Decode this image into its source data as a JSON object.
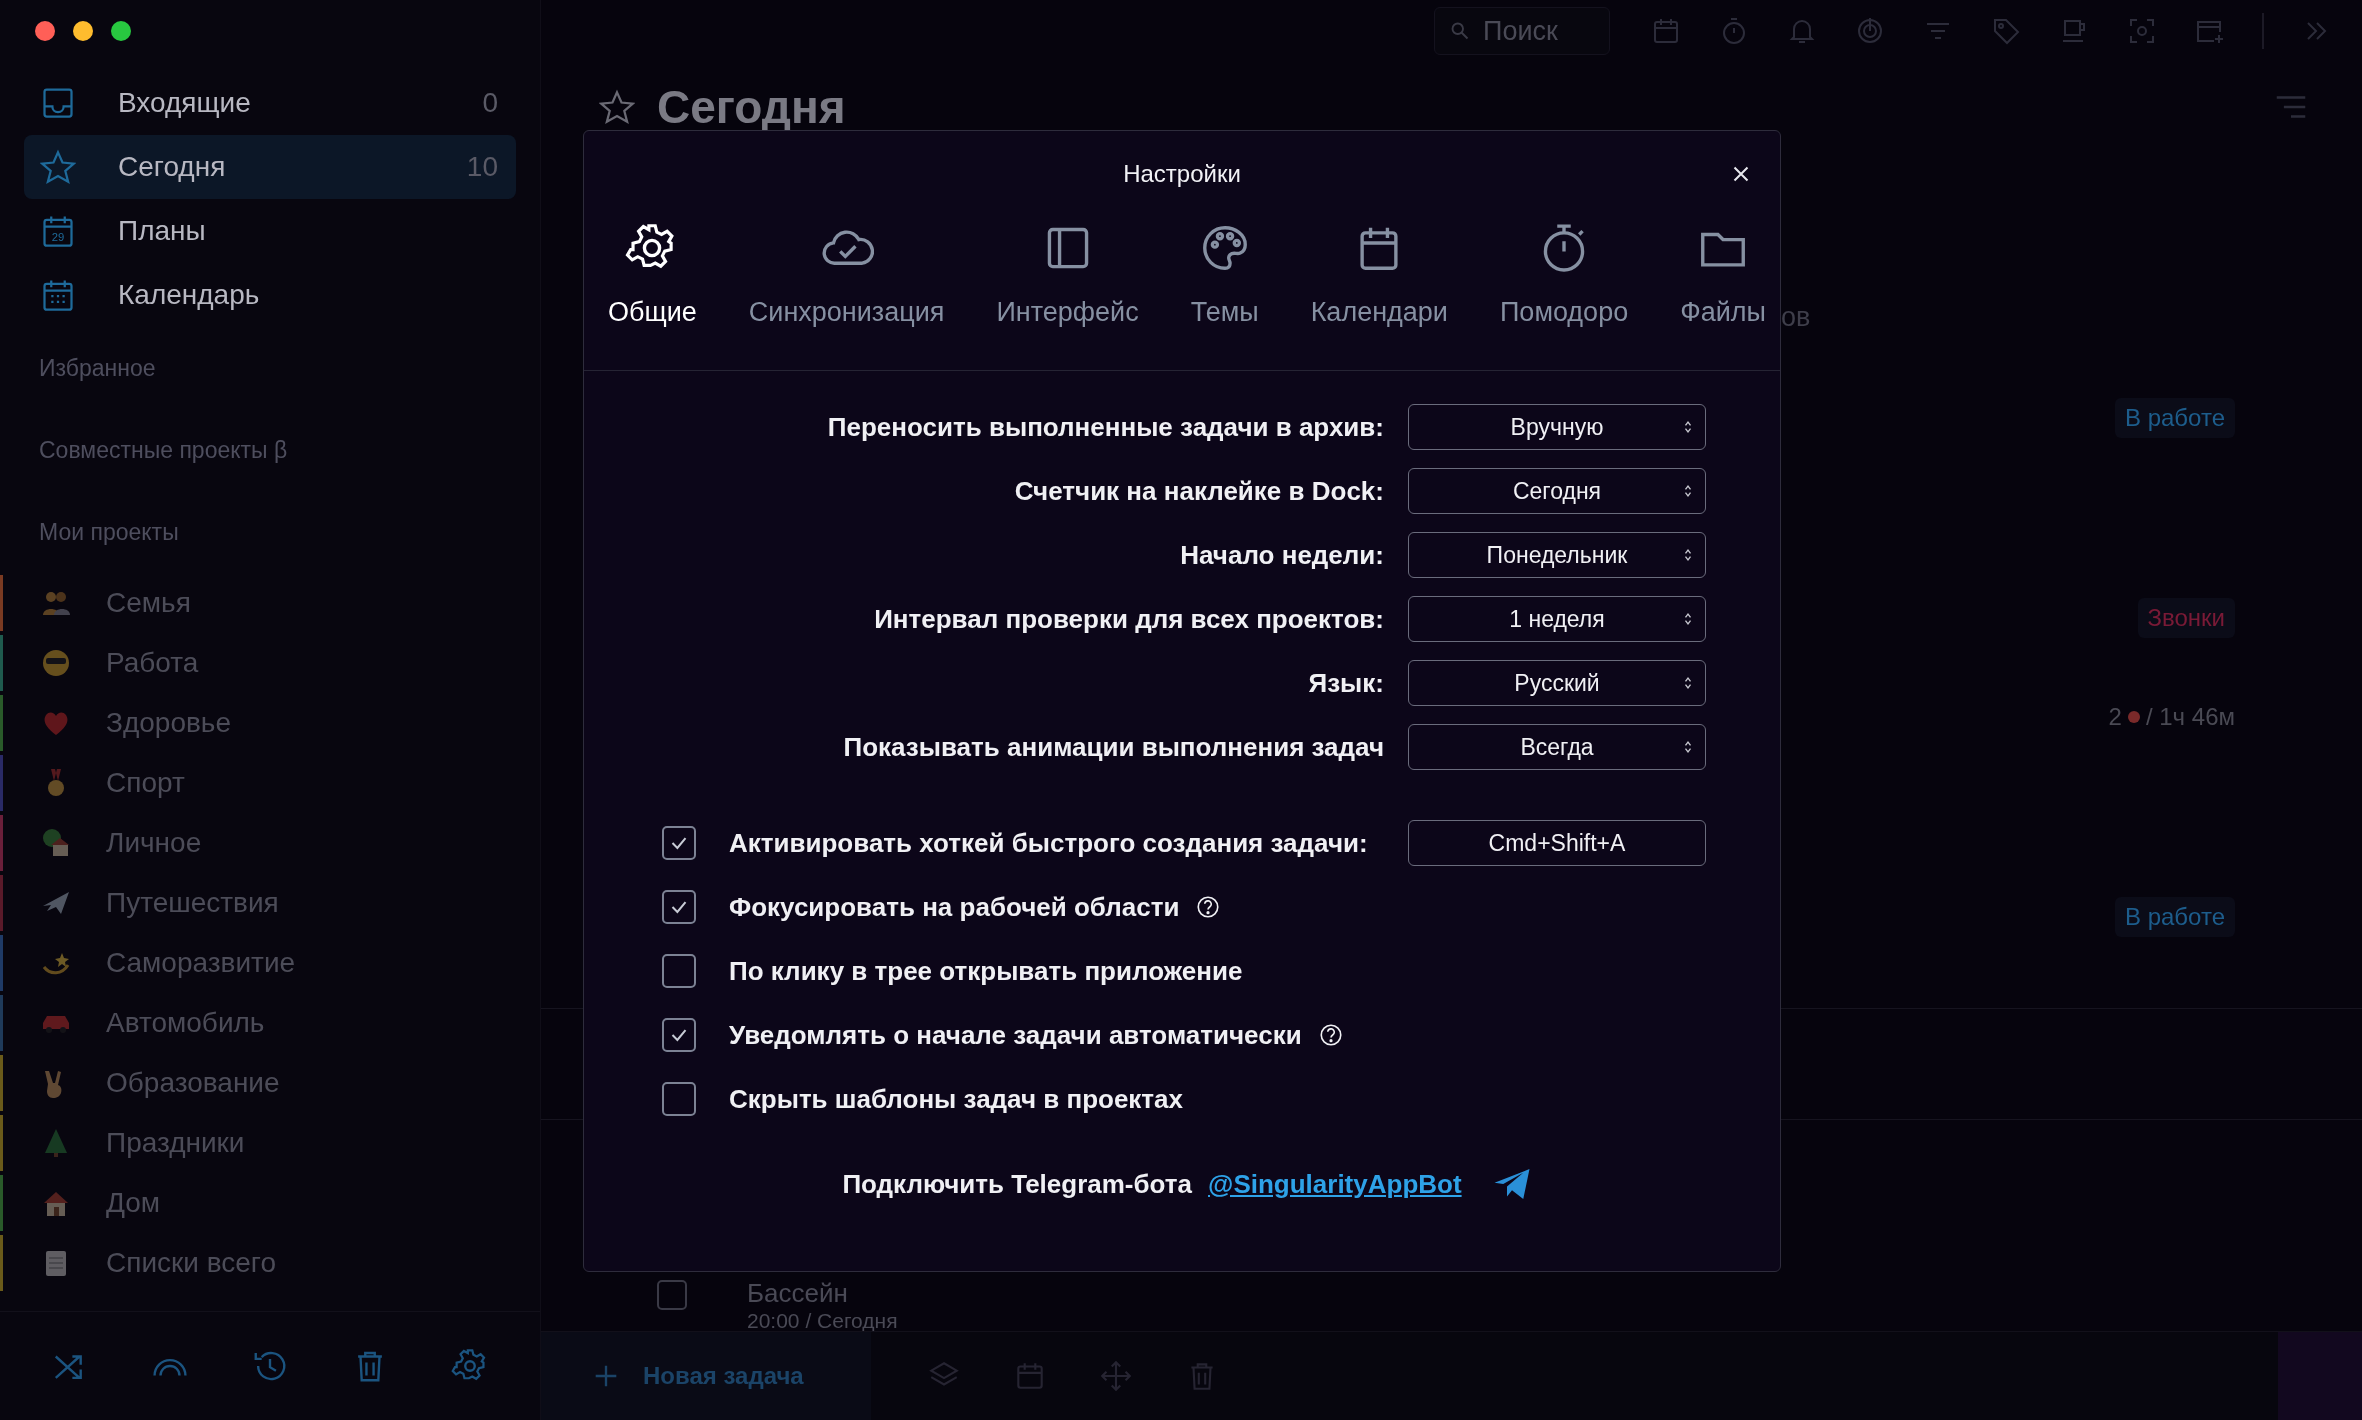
{
  "window": {
    "controls": [
      {
        "color": "#ff5f57"
      },
      {
        "color": "#febc2e"
      },
      {
        "color": "#28c840"
      }
    ]
  },
  "sidebar": {
    "nav": [
      {
        "label": "Входящие",
        "count": "0",
        "selected": false
      },
      {
        "label": "Сегодня",
        "count": "10",
        "selected": true
      },
      {
        "label": "Планы",
        "icon_day": "29",
        "selected": false
      },
      {
        "label": "Календарь",
        "selected": false
      }
    ],
    "sections": [
      "Избранное",
      "Совместные проекты β"
    ],
    "projects_heading": "Мои проекты",
    "projects": [
      {
        "name": "Семья",
        "color": "#7a3a22"
      },
      {
        "name": "Работа",
        "color": "#1f5a4e"
      },
      {
        "name": "Здоровье",
        "color": "#2a5a2a"
      },
      {
        "name": "Спорт",
        "color": "#2a2a66"
      },
      {
        "name": "Личное",
        "color": "#6a1f3a"
      },
      {
        "name": "Путешествия",
        "color": "#5a1a2a"
      },
      {
        "name": "Саморазвитие",
        "color": "#1f3a66"
      },
      {
        "name": "Автомобиль",
        "color": "#1f3a5a"
      },
      {
        "name": "Образование",
        "color": "#6a5a1a"
      },
      {
        "name": "Праздники",
        "color": "#6a5a1a"
      },
      {
        "name": "Дом",
        "color": "#2a5a2a"
      },
      {
        "name": "Списки всего",
        "color": "#6a5a1a"
      }
    ]
  },
  "toolbar": {
    "search": {
      "placeholder": "Поиск"
    }
  },
  "page": {
    "title": "Сегодня",
    "hidden_tab_tail": "ов"
  },
  "background_tasks": [
    {
      "kind": "badge",
      "text": "В работе",
      "color": "#1d5d8c"
    },
    {
      "kind": "badge",
      "text": "Звонки",
      "color": "#7a1a36"
    },
    {
      "kind": "meta",
      "count": "2",
      "time": "/ 1ч 46м",
      "color": "#7a2a2a"
    },
    {
      "kind": "badge",
      "text": "В работе",
      "color": "#1d5d8c"
    }
  ],
  "task": {
    "title": "Бассейн",
    "when": "20:00 / Сегодня",
    "checked": false
  },
  "bottom_bar": {
    "new_task": "Новая задача"
  },
  "dialog": {
    "title": "Настройки",
    "tabs": [
      {
        "label": "Общие",
        "selected": true
      },
      {
        "label": "Синхронизация",
        "selected": false
      },
      {
        "label": "Интерфейс",
        "selected": false
      },
      {
        "label": "Темы",
        "selected": false
      },
      {
        "label": "Календари",
        "selected": false
      },
      {
        "label": "Помодоро",
        "selected": false
      },
      {
        "label": "Файлы",
        "selected": false
      }
    ],
    "selects": [
      {
        "label": "Переносить выполненные задачи в архив:",
        "value": "Вручную"
      },
      {
        "label": "Счетчик на наклейке в Dock:",
        "value": "Сегодня"
      },
      {
        "label": "Начало недели:",
        "value": "Понедельник"
      },
      {
        "label": "Интервал проверки для всех проектов:",
        "value": "1 неделя"
      },
      {
        "label": "Язык:",
        "value": "Русский"
      },
      {
        "label": "Показывать анимации выполнения задач",
        "value": "Всегда"
      }
    ],
    "options": [
      {
        "label": "Активировать хоткей быстрого создания задачи:",
        "checked": true,
        "help": false,
        "hotkey": "Cmd+Shift+A"
      },
      {
        "label": "Фокусировать на рабочей области",
        "checked": true,
        "help": true
      },
      {
        "label": "По клику в трее открывать приложение",
        "checked": false,
        "help": false
      },
      {
        "label": "Уведомлять о начале задачи автоматически",
        "checked": true,
        "help": true
      },
      {
        "label": "Скрыть шаблоны задач в проектах",
        "checked": false,
        "help": false
      }
    ],
    "telegram": {
      "text": "Подключить Telegram-бота",
      "link": "@SingularityAppBot"
    }
  }
}
